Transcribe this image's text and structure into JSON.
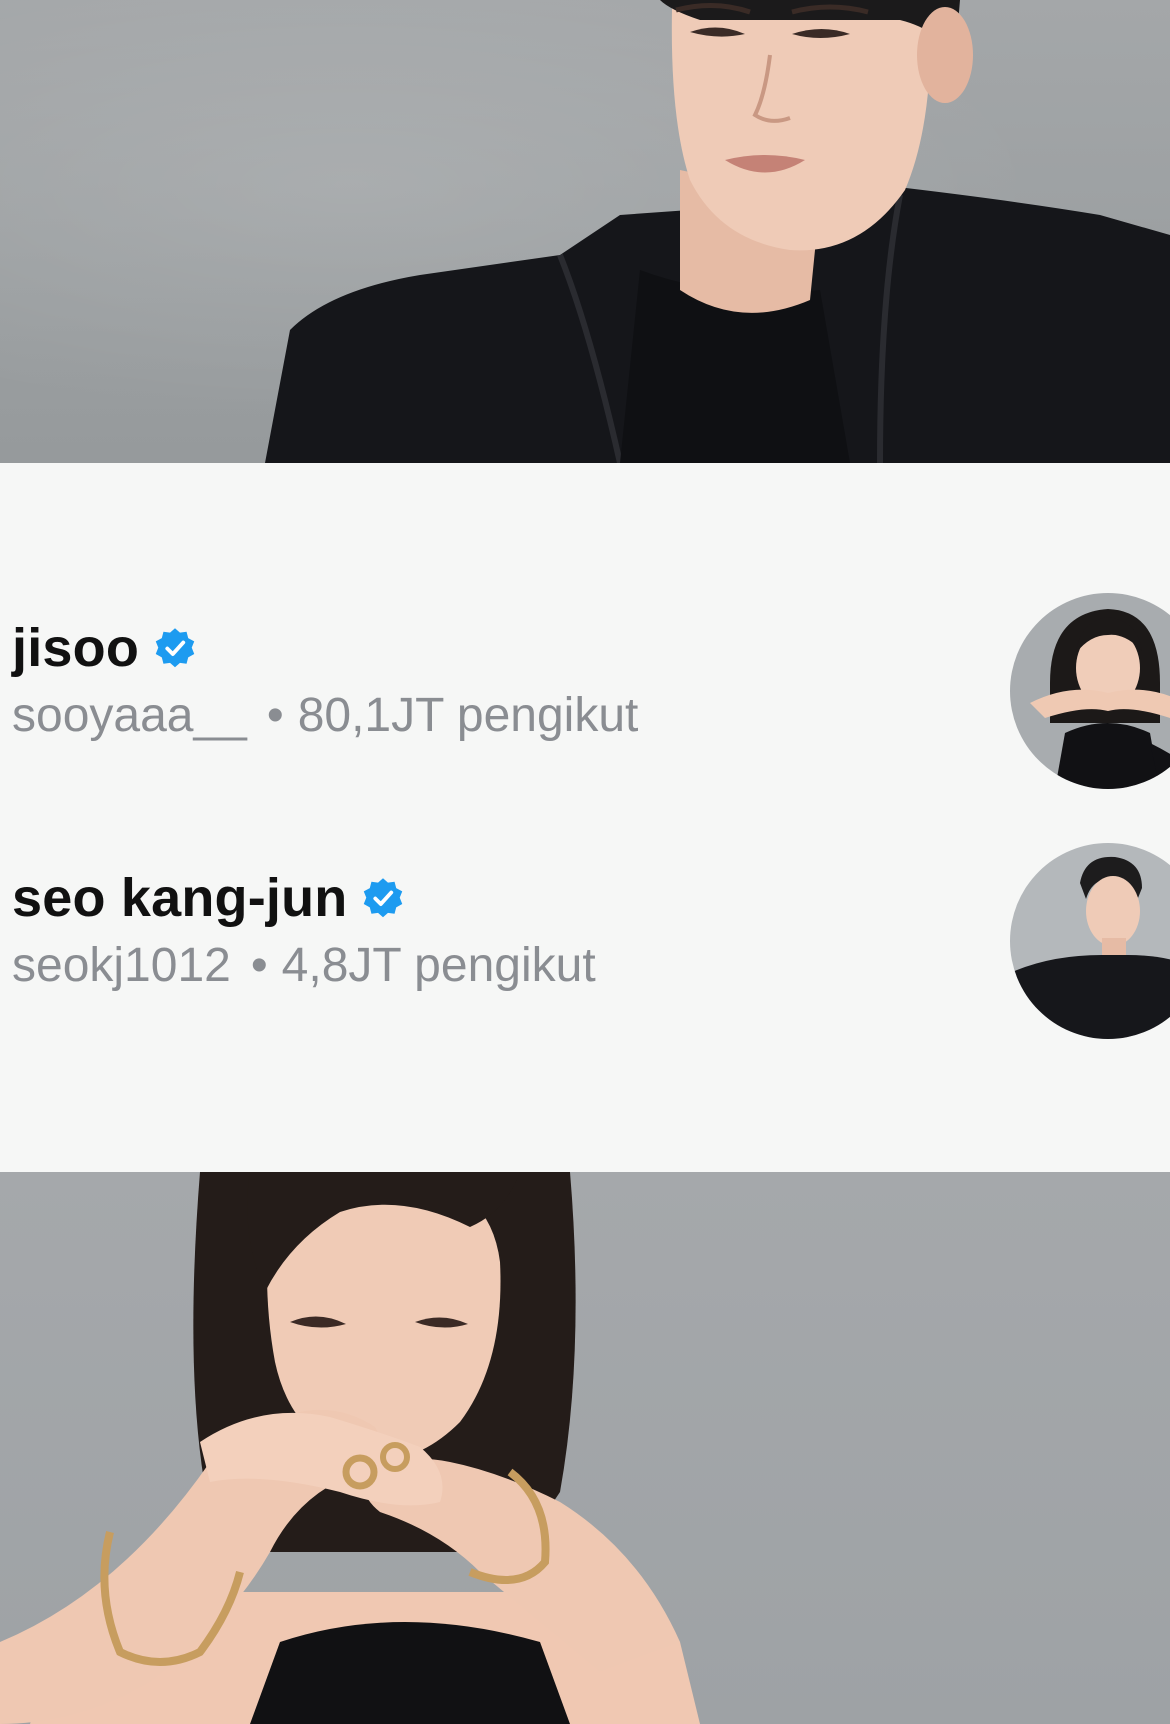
{
  "accounts": [
    {
      "display_name": "jisoo",
      "username": "sooyaaa__",
      "followers": "80,1JT pengikut",
      "verified": true
    },
    {
      "display_name": "seo kang-jun",
      "username": "seokj1012",
      "followers": "4,8JT pengikut",
      "verified": true
    }
  ],
  "separator": "•",
  "colors": {
    "verified_badge": "#1d9bf0",
    "name_text": "#111111",
    "secondary_text": "#8a8d92",
    "card_background": "#f6f7f6",
    "photo_background": "#a0a4a7"
  }
}
